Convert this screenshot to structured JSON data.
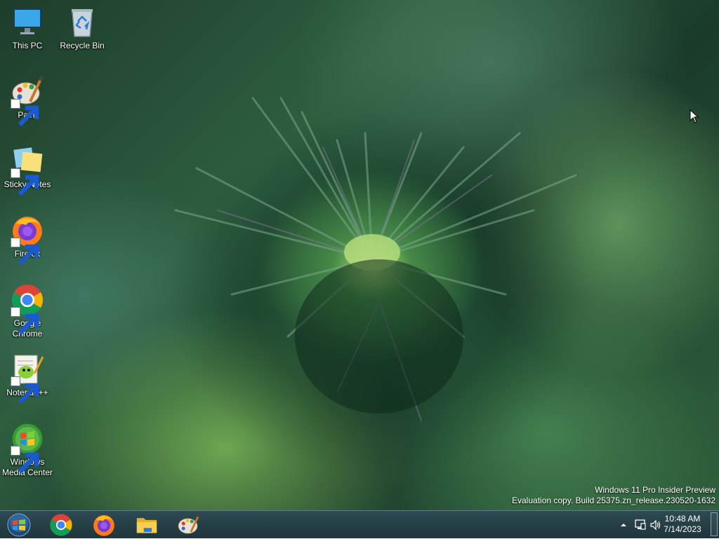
{
  "desktop": {
    "icons": [
      {
        "label": "This PC",
        "icon": "computer-icon",
        "shortcut": false
      },
      {
        "label": "Recycle Bin",
        "icon": "recycle-bin-icon",
        "shortcut": false
      },
      {
        "label": "Paint",
        "icon": "paint-palette-icon",
        "shortcut": true
      },
      {
        "label": "Sticky Notes",
        "icon": "sticky-notes-icon",
        "shortcut": true
      },
      {
        "label": "Firefox",
        "icon": "firefox-icon",
        "shortcut": true
      },
      {
        "label": "Google Chrome",
        "icon": "chrome-icon",
        "shortcut": true
      },
      {
        "label": "Notepad++",
        "icon": "notepad-plus-plus-icon",
        "shortcut": true
      },
      {
        "label": "Windows Media Center",
        "icon": "windows-media-center-icon",
        "shortcut": true
      }
    ],
    "watermark": {
      "line1": "Windows 11 Pro Insider Preview",
      "line2": "Evaluation copy. Build 25375.zn_release.230520-1632"
    }
  },
  "taskbar": {
    "start": {
      "icon": "windows-start-orb-icon"
    },
    "pinned": [
      {
        "name": "Google Chrome",
        "icon": "chrome-icon"
      },
      {
        "name": "Firefox",
        "icon": "firefox-icon"
      },
      {
        "name": "File Explorer",
        "icon": "folder-icon"
      },
      {
        "name": "Paint",
        "icon": "paint-palette-icon"
      }
    ],
    "tray": {
      "overflow_icon": "chevron-up-icon",
      "network_icon": "network-icon",
      "volume_icon": "speaker-icon",
      "time": "10:48 AM",
      "date": "7/14/2023"
    }
  },
  "colors": {
    "taskbar": "#1e353c",
    "desktop_base": "#2f5e3f",
    "accent": "#4a90d9"
  }
}
